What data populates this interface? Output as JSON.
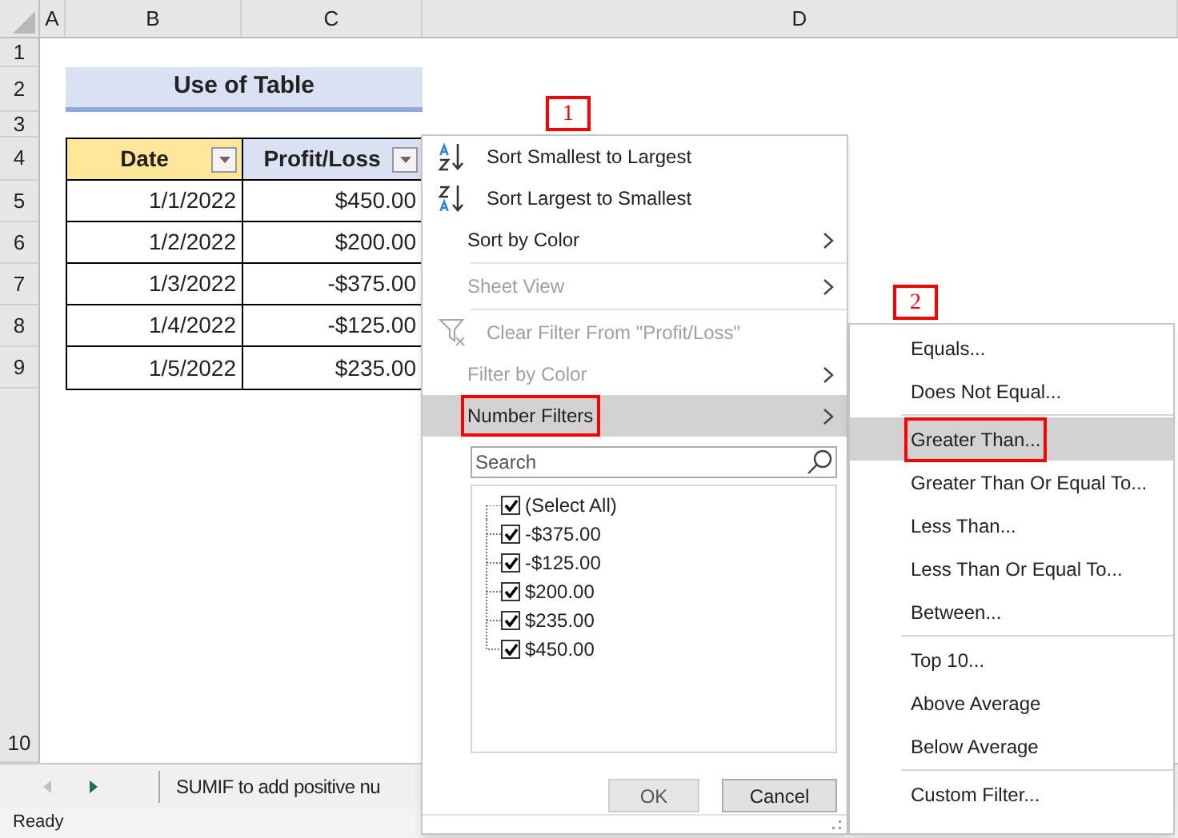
{
  "columns": [
    "A",
    "B",
    "C",
    "D"
  ],
  "row_numbers": [
    "1",
    "2",
    "3",
    "4",
    "5",
    "6",
    "7",
    "8",
    "9",
    "10"
  ],
  "table_title": "Use of Table",
  "table": {
    "headers": [
      "Date",
      "Profit/Loss"
    ],
    "rows": [
      [
        "1/1/2022",
        "$450.00"
      ],
      [
        "1/2/2022",
        "$200.00"
      ],
      [
        "1/3/2022",
        "-$375.00"
      ],
      [
        "1/4/2022",
        "-$125.00"
      ],
      [
        "1/5/2022",
        "$235.00"
      ]
    ]
  },
  "filter_menu": {
    "items": [
      {
        "kind": "sort-asc",
        "label": "Sort Smallest to Largest",
        "disabled": false,
        "submenu": false,
        "selected": false,
        "annotated": false
      },
      {
        "kind": "sort-desc",
        "label": "Sort Largest to Smallest",
        "disabled": false,
        "submenu": false,
        "selected": false,
        "annotated": false
      },
      {
        "kind": "item",
        "label": "Sort by Color",
        "disabled": false,
        "submenu": true,
        "selected": false,
        "annotated": false
      },
      {
        "kind": "divider"
      },
      {
        "kind": "item",
        "label": "Sheet View",
        "disabled": true,
        "submenu": true,
        "selected": false,
        "annotated": false
      },
      {
        "kind": "divider"
      },
      {
        "kind": "clear",
        "label": "Clear Filter From \"Profit/Loss\"",
        "disabled": true,
        "submenu": false,
        "selected": false,
        "annotated": false
      },
      {
        "kind": "item",
        "label": "Filter by Color",
        "disabled": true,
        "submenu": true,
        "selected": false,
        "annotated": false
      },
      {
        "kind": "item",
        "label": "Number Filters",
        "disabled": false,
        "submenu": true,
        "selected": true,
        "annotated": true
      }
    ],
    "search": {
      "placeholder": "Search"
    },
    "values": [
      {
        "label": "(Select All)",
        "checked": true
      },
      {
        "label": "-$375.00",
        "checked": true
      },
      {
        "label": "-$125.00",
        "checked": true
      },
      {
        "label": "$200.00",
        "checked": true
      },
      {
        "label": "$235.00",
        "checked": true
      },
      {
        "label": "$450.00",
        "checked": true
      }
    ],
    "buttons": [
      "OK",
      "Cancel"
    ]
  },
  "number_filters_menu": [
    {
      "kind": "item",
      "label": "Equals...",
      "selected": false,
      "annotated": false
    },
    {
      "kind": "item",
      "label": "Does Not Equal...",
      "selected": false,
      "annotated": false
    },
    {
      "kind": "divider"
    },
    {
      "kind": "item",
      "label": "Greater Than...",
      "selected": true,
      "annotated": true
    },
    {
      "kind": "item",
      "label": "Greater Than Or Equal To...",
      "selected": false,
      "annotated": false
    },
    {
      "kind": "item",
      "label": "Less Than...",
      "selected": false,
      "annotated": false
    },
    {
      "kind": "item",
      "label": "Less Than Or Equal To...",
      "selected": false,
      "annotated": false
    },
    {
      "kind": "item",
      "label": "Between...",
      "selected": false,
      "annotated": false
    },
    {
      "kind": "divider"
    },
    {
      "kind": "item",
      "label": "Top 10...",
      "selected": false,
      "annotated": false
    },
    {
      "kind": "item",
      "label": "Above Average",
      "selected": false,
      "annotated": false
    },
    {
      "kind": "item",
      "label": "Below Average",
      "selected": false,
      "annotated": false
    },
    {
      "kind": "divider"
    },
    {
      "kind": "item",
      "label": "Custom Filter...",
      "selected": false,
      "annotated": false
    }
  ],
  "step_labels": [
    "1",
    "2"
  ],
  "sheet_tab": "SUMIF to add positive nu",
  "status_bar": "Ready"
}
